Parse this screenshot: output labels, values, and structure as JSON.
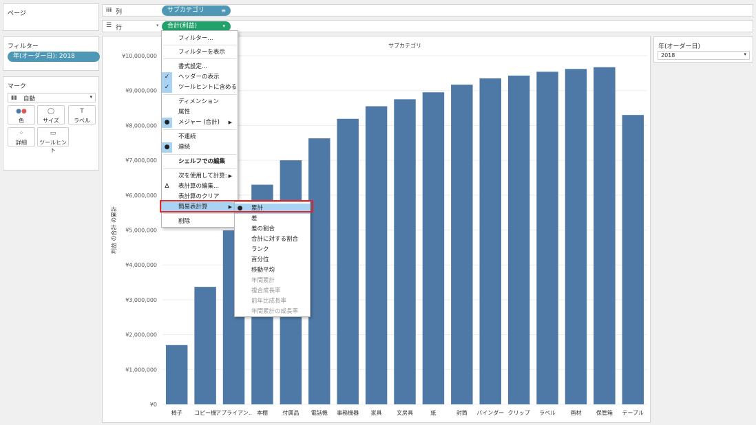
{
  "left_panel": {
    "pages_title": "ページ",
    "filters_title": "フィルター",
    "filter_pill": "年(オーダー日): 2018",
    "marks_title": "マーク",
    "marks_type": "自動",
    "mark_buttons": [
      {
        "label": "色",
        "icon": "color-dots-icon"
      },
      {
        "label": "サイズ",
        "icon": "size-icon"
      },
      {
        "label": "ラベル",
        "icon": "label-icon"
      },
      {
        "label": "詳細",
        "icon": "detail-icon"
      },
      {
        "label": "ツールヒント",
        "icon": "tooltip-icon"
      }
    ]
  },
  "shelves": {
    "columns_label": "列",
    "rows_label": "行",
    "columns_pill": "サブカテゴリ",
    "rows_pill": "合計(利益)"
  },
  "right_panel": {
    "title": "年(オーダー日)",
    "dropdown_value": "2018"
  },
  "context_menu": {
    "items": [
      {
        "label": "フィルター...",
        "lead": "",
        "arrow": false,
        "bold": false
      },
      {
        "label": "フィルターを表示",
        "lead": "",
        "arrow": false,
        "bold": false
      },
      {
        "label": "書式設定...",
        "lead": "",
        "arrow": false,
        "bold": false
      },
      {
        "label": "ヘッダーの表示",
        "lead": "✓",
        "arrow": false,
        "bold": false
      },
      {
        "label": "ツールヒントに含める",
        "lead": "✓",
        "arrow": false,
        "bold": false
      },
      {
        "label": "ディメンション",
        "lead": "",
        "arrow": false,
        "bold": false
      },
      {
        "label": "属性",
        "lead": "",
        "arrow": false,
        "bold": false
      },
      {
        "label": "メジャー (合計)",
        "lead": "●",
        "arrow": true,
        "bold": false
      },
      {
        "label": "不連続",
        "lead": "",
        "arrow": false,
        "bold": false
      },
      {
        "label": "連続",
        "lead": "●",
        "arrow": false,
        "bold": false
      },
      {
        "label": "シェルフでの編集",
        "lead": "",
        "arrow": false,
        "bold": true
      },
      {
        "label": "次を使用して計算:",
        "lead": "",
        "arrow": true,
        "bold": false
      },
      {
        "label": "表計算の編集...",
        "lead": "Δ",
        "arrow": false,
        "bold": false
      },
      {
        "label": "表計算のクリア",
        "lead": "",
        "arrow": false,
        "bold": false
      },
      {
        "label": "簡易表計算",
        "lead": "",
        "arrow": true,
        "bold": false
      },
      {
        "label": "削除",
        "lead": "",
        "arrow": false,
        "bold": false
      }
    ]
  },
  "submenu": {
    "items": [
      {
        "label": "累計",
        "lead": "●",
        "dim": false
      },
      {
        "label": "差",
        "lead": "",
        "dim": false
      },
      {
        "label": "差の割合",
        "lead": "",
        "dim": false
      },
      {
        "label": "合計に対する割合",
        "lead": "",
        "dim": false
      },
      {
        "label": "ランク",
        "lead": "",
        "dim": false
      },
      {
        "label": "百分位",
        "lead": "",
        "dim": false
      },
      {
        "label": "移動平均",
        "lead": "",
        "dim": false
      },
      {
        "label": "年間累計",
        "lead": "",
        "dim": true
      },
      {
        "label": "複合成長率",
        "lead": "",
        "dim": true
      },
      {
        "label": "前年比成長率",
        "lead": "",
        "dim": true
      },
      {
        "label": "年間累計の成長率",
        "lead": "",
        "dim": true
      }
    ]
  },
  "colors": {
    "bar": "#4e79a7",
    "pill_blue": "#4e98b5",
    "pill_green": "#21a26b",
    "highlight": "#e0262b",
    "menu_selected": "#a9d3f2"
  },
  "chart_data": {
    "type": "bar",
    "title": "サブカテゴリ",
    "ylabel": "利益 の合計 の累計",
    "ylim": [
      0,
      10000000
    ],
    "yticks": [
      0,
      1000000,
      2000000,
      3000000,
      4000000,
      5000000,
      6000000,
      7000000,
      8000000,
      9000000,
      10000000
    ],
    "ytick_labels": [
      "¥0",
      "¥1,000,000",
      "¥2,000,000",
      "¥3,000,000",
      "¥4,000,000",
      "¥5,000,000",
      "¥6,000,000",
      "¥7,000,000",
      "¥8,000,000",
      "¥9,000,000",
      "¥10,000,000"
    ],
    "categories": [
      "椅子",
      "コピー機",
      "アプライアン..",
      "本棚",
      "付属品",
      "電話機",
      "事務機器",
      "家具",
      "文房具",
      "紙",
      "封筒",
      "バインダー",
      "クリップ",
      "ラベル",
      "画材",
      "保管箱",
      "テーブル"
    ],
    "values": [
      1700000,
      3370000,
      4990000,
      6300000,
      7000000,
      7630000,
      8190000,
      8550000,
      8750000,
      8950000,
      9170000,
      9350000,
      9430000,
      9540000,
      9620000,
      9670000,
      8300000
    ]
  }
}
